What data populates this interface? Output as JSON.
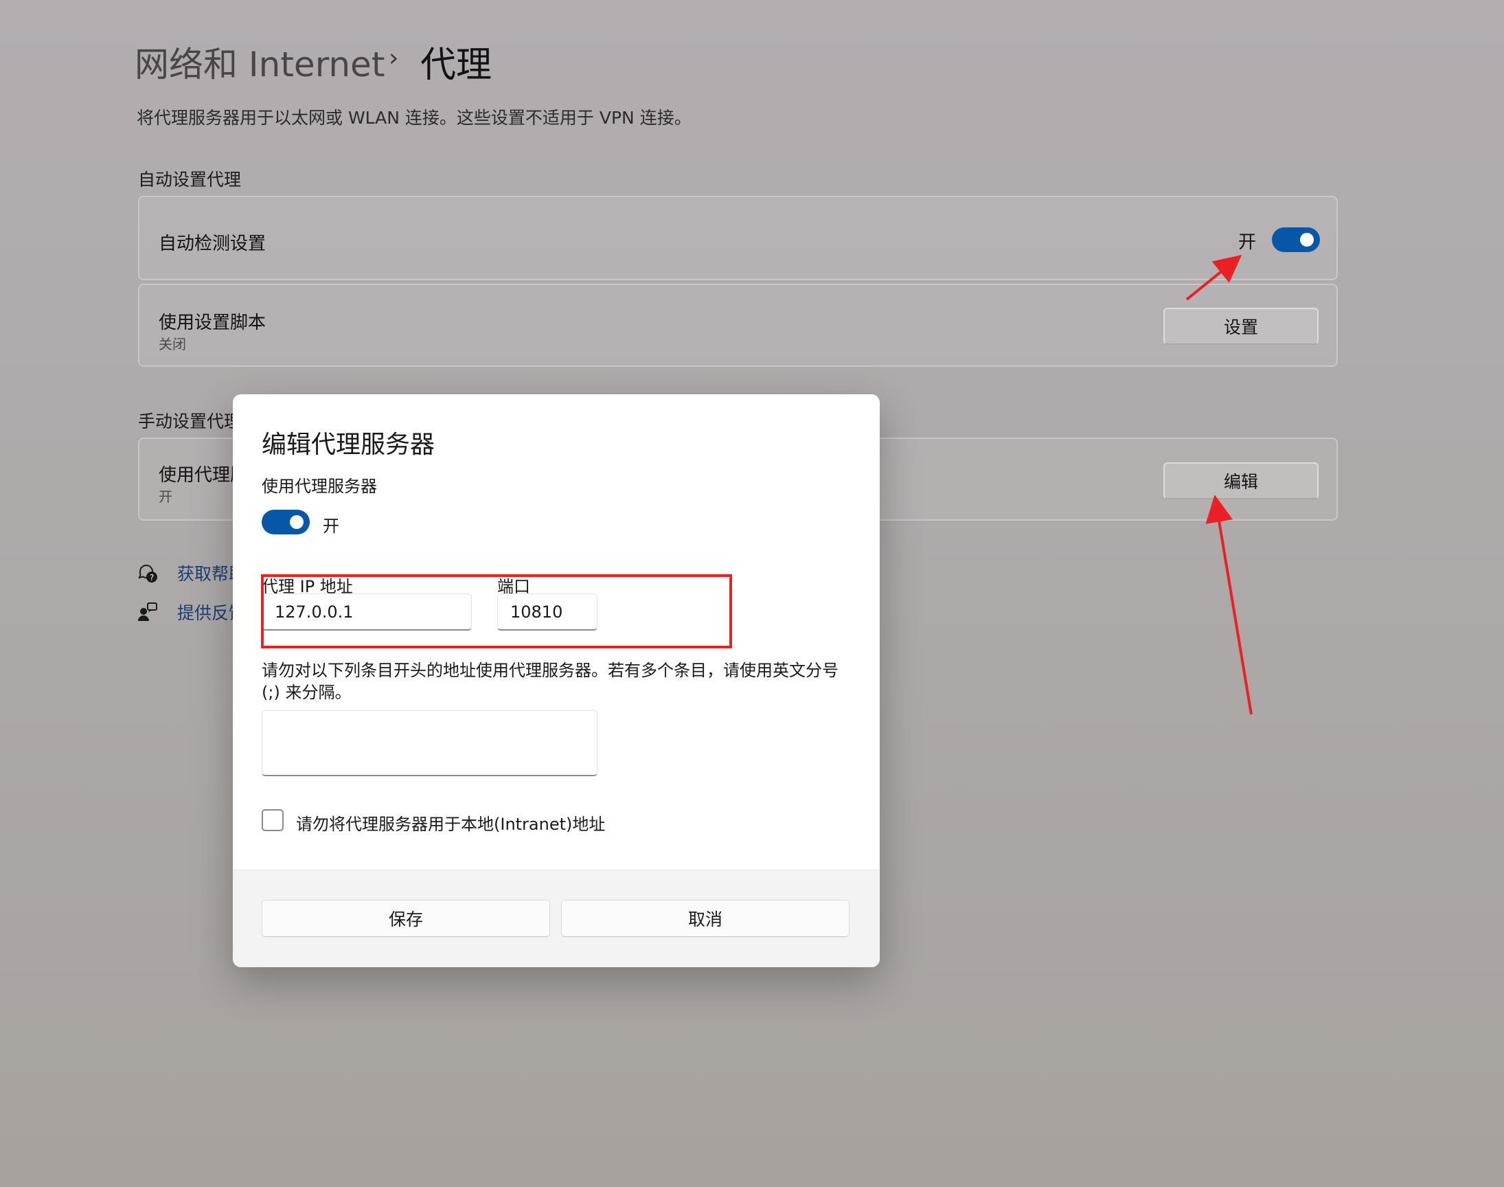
{
  "breadcrumb": {
    "parent": "网络和 Internet",
    "separator": "›",
    "current": "代理"
  },
  "description": "将代理服务器用于以太网或 WLAN 连接。这些设置不适用于 VPN 连接。",
  "auto_section": {
    "title": "自动设置代理",
    "auto_detect": {
      "label": "自动检测设置",
      "state_label": "开",
      "on": true
    },
    "setup_script": {
      "label": "使用设置脚本",
      "sub": "关闭",
      "button": "设置"
    }
  },
  "manual_section": {
    "title": "手动设置代理",
    "use_proxy": {
      "label": "使用代理服务器",
      "sub": "开",
      "button": "编辑"
    }
  },
  "links": {
    "help": "获取帮助",
    "feedback": "提供反馈"
  },
  "dialog": {
    "title": "编辑代理服务器",
    "use_proxy_label": "使用代理服务器",
    "toggle_state_label": "开",
    "toggle_on": true,
    "ip_label": "代理 IP 地址",
    "ip_value": "127.0.0.1",
    "port_label": "端口",
    "port_value": "10810",
    "exceptions_label_line1": "请勿对以下列条目开头的地址使用代理服务器。若有多个条目，请使用英文分号",
    "exceptions_label_line2": "(;) 来分隔。",
    "exceptions_value": "",
    "local_checkbox_label": "请勿将代理服务器用于本地(Intranet)地址",
    "local_checked": false,
    "save_button": "保存",
    "cancel_button": "取消"
  },
  "colors": {
    "accent": "#0657a8",
    "annotation": "#ea2025",
    "link": "#1b3e72"
  }
}
